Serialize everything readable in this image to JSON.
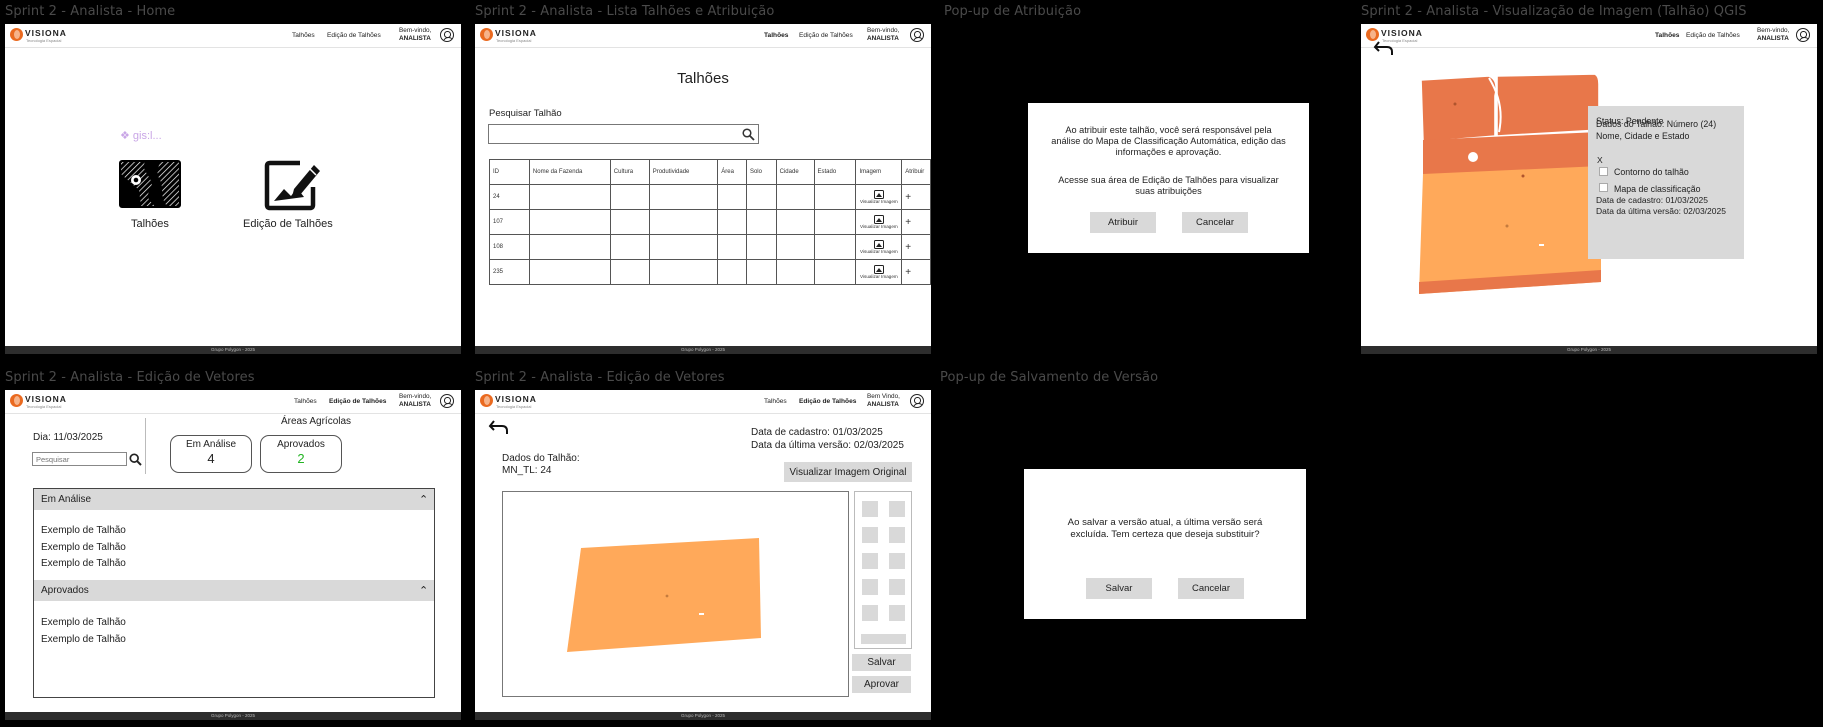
{
  "brand": {
    "name": "VISIONA",
    "tagline": "Tecnologia Espacial"
  },
  "nav": {
    "talhoes": "Talhões",
    "edicao": "Edição de Talhões"
  },
  "welcome": {
    "line1": "Bem-vindo,",
    "line1_alt": "Bem Vindo,",
    "role": "ANALISTA"
  },
  "footer": "Grupo Polygon - 2025",
  "colors": {
    "brand": "#ea6a20",
    "field_orange": "#e8774a",
    "field_light": "#ffa95a",
    "approved": "#22b422",
    "panel": "#d9d9d9"
  },
  "frames": {
    "f1": {
      "title": "Sprint 2 - Analista - Home",
      "placeholder": "❖ gis:l...",
      "tile1": "Talhões",
      "tile1_icon": "map-pattern-icon",
      "tile2": "Edição de Talhões",
      "tile2_icon": "edit-image-icon"
    },
    "f2": {
      "title": "Sprint 2 - Analista - Lista Talhões e Atribuição",
      "heading": "Talhões",
      "search_label": "Pesquisar Talhão",
      "columns": [
        "ID",
        "Nome da Fazenda",
        "Cultura",
        "Produtividade",
        "Área",
        "Solo",
        "Cidade",
        "Estado",
        "Imagem",
        "Atribuir"
      ],
      "rows": [
        {
          "id": "24"
        },
        {
          "id": "107"
        },
        {
          "id": "108"
        },
        {
          "id": "235"
        }
      ],
      "view_image": "Visualizar Imagem",
      "assign_symbol": "+"
    },
    "f3": {
      "title": "Pop-up de Atribuição",
      "text1": "Ao atribuir este talhão, você será responsável pela análise do Mapa de Classificação Automática, edição das informações e aprovação.",
      "text2": "Acesse sua área de Edição de Talhões para visualizar suas atribuições",
      "confirm": "Atribuir",
      "cancel": "Cancelar"
    },
    "f4": {
      "title": "Sprint 2 - Analista - Visualização de Imagem (Talhão) QGIS",
      "status": "Status: Pendente",
      "dados": "Dados do Talhão: Número (24)",
      "local": "Nome, Cidade e Estado",
      "close": "X",
      "layer1": "Contorno do talhão",
      "layer2": "Mapa de classificação",
      "cadastro": "Data de cadastro: 01/03/2025",
      "versao": "Data da última versão: 02/03/2025"
    },
    "f5": {
      "title": "Sprint 2 - Analista - Edição de Vetores",
      "dia": "Dia: 11/03/2025",
      "search_placeholder": "Pesquisar",
      "areas_title": "Áreas Agrícolas",
      "card1_label": "Em Análise",
      "card1_value": "4",
      "card2_label": "Aprovados",
      "card2_value": "2",
      "section1": "Em Análise",
      "section1_items": [
        "Exemplo de Talhão",
        "Exemplo de Talhão",
        "Exemplo de Talhão"
      ],
      "section2": "Aprovados",
      "section2_items": [
        "Exemplo de Talhão",
        "Exemplo de Talhão"
      ],
      "chevron": "⌃"
    },
    "f6": {
      "title": "Sprint 2 - Analista - Edição de Vetores",
      "cadastro": "Data de cadastro: 01/03/2025",
      "versao": "Data da última versão: 02/03/2025",
      "dados": "Dados do Talhão:",
      "id": "MN_TL: 24",
      "view_original": "Visualizar Imagem Original",
      "save": "Salvar",
      "approve": "Aprovar"
    },
    "f7": {
      "title": "Pop-up de Salvamento de Versão",
      "text": "Ao salvar a versão atual, a última versão será excluída. Tem certeza que deseja substituir?",
      "save": "Salvar",
      "cancel": "Cancelar"
    }
  }
}
